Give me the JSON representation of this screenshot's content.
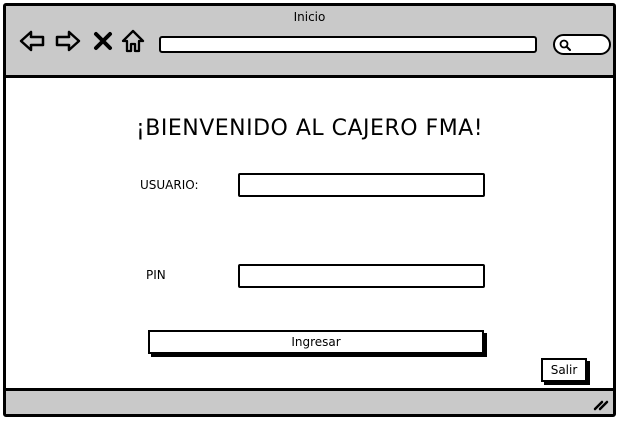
{
  "window": {
    "title": "Inicio"
  },
  "toolbar": {
    "icons": [
      "back-arrow-icon",
      "forward-arrow-icon",
      "close-x-icon",
      "home-icon",
      "search-icon"
    ],
    "address_value": ""
  },
  "login": {
    "heading": "¡BIENVENIDO AL CAJERO FMA!",
    "user_label": "USUARIO:",
    "user_value": "",
    "pin_label": "PIN",
    "pin_value": "",
    "submit_label": "Ingresar",
    "exit_label": "Salir"
  },
  "colors": {
    "chrome": "#c9c9c9",
    "border": "#000000",
    "background": "#ffffff"
  }
}
